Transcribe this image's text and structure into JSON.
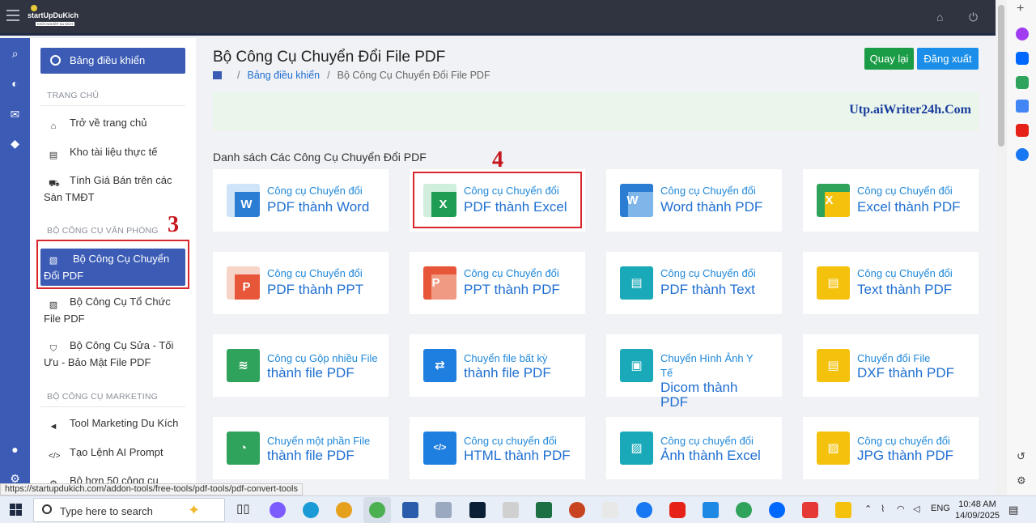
{
  "header": {
    "logo_text": "startUpDuKich",
    "logo_tagline": "KHỞI NGHIỆP DU KÍCH"
  },
  "sidebar": {
    "dashboard_label": "Bảng điều khiển",
    "section_home": "TRANG CHỦ",
    "home_items": [
      "Trở về trang chủ",
      "Kho tài liệu thực tế",
      "Tính Giá Bán trên các Sàn TMĐT"
    ],
    "section_office": "BỘ CÔNG CỤ VĂN PHÒNG",
    "office_items": [
      "Bộ Công Cụ Chuyển Đổi PDF",
      "Bộ Công Cụ Tổ Chức File PDF",
      "Bộ Công Cụ Sửa - Tối Ưu - Bảo Mật File PDF"
    ],
    "section_marketing": "BỘ CÔNG CỤ MARKETING",
    "marketing_items": [
      "Tool Marketing Du Kích",
      "Tạo Lệnh AI Prompt",
      "Bộ hơn 50 công cụ"
    ]
  },
  "annotations": {
    "step3": "3",
    "step4": "4"
  },
  "main": {
    "title": "Bộ Công Cụ Chuyển Đổi File PDF",
    "breadcrumb_link": "Bảng điều khiển",
    "breadcrumb_current": "Bộ Công Cụ Chuyển Đổi File PDF",
    "back_button": "Quay lại",
    "logout_button": "Đăng xuất",
    "banner_brand": "Utp.aiWriter24h.Com",
    "list_title": "Danh sách Các Công Cụ Chuyển Đổi PDF",
    "cards": [
      {
        "line1": "Công cụ Chuyển đổi",
        "line2": "PDF thành Word",
        "glyph": "W"
      },
      {
        "line1": "Công cụ Chuyển đổi",
        "line2": "PDF thành Excel",
        "glyph": "X"
      },
      {
        "line1": "Công cụ Chuyển đổi",
        "line2": "Word thành PDF",
        "glyph": "W"
      },
      {
        "line1": "Công cụ Chuyển đổi",
        "line2": "Excel thành PDF",
        "glyph": "X"
      },
      {
        "line1": "Công cụ Chuyển đổi",
        "line2": "PDF thành PPT",
        "glyph": "P"
      },
      {
        "line1": "Công cụ Chuyển đổi",
        "line2": "PPT thành PDF",
        "glyph": "P"
      },
      {
        "line1": "Công cụ Chuyển đổi",
        "line2": "PDF thành Text",
        "glyph": "▤"
      },
      {
        "line1": "Công cụ Chuyển đổi",
        "line2": "Text thành PDF",
        "glyph": "▤"
      },
      {
        "line1": "Công cụ Gộp nhiều File",
        "line2": "thành file PDF",
        "glyph": "≋"
      },
      {
        "line1": "Chuyển file bất kỳ",
        "line2": "thành file PDF",
        "glyph": "⇄"
      },
      {
        "line1": "Chuyển Hình Ảnh Y Tế",
        "line2": "Dicom thành PDF",
        "glyph": "▣"
      },
      {
        "line1": "Chuyển đổi File",
        "line2": "DXF thành PDF",
        "glyph": "▤"
      },
      {
        "line1": "Chuyển một phần File",
        "line2": "thành file PDF",
        "glyph": "◔"
      },
      {
        "line1": "Công cụ chuyển đổi",
        "line2": "HTML thành PDF",
        "glyph": "</>"
      },
      {
        "line1": "Công cụ chuyển đổi",
        "line2": "Ảnh thành Excel",
        "glyph": "▨"
      },
      {
        "line1": "Công cụ chuyển đổi",
        "line2": "JPG thành PDF",
        "glyph": "▨"
      }
    ]
  },
  "status_url": "https://startupdukich.com/addon-tools/free-tools/pdf-tools/pdf-convert-tools",
  "taskbar": {
    "search_placeholder": "Type here to search",
    "language": "ENG",
    "time": "10:48 AM",
    "date": "14/09/2025"
  },
  "colors": {
    "accent": "#3b5bb5",
    "topbar": "#2f3440",
    "link": "#1f6fd1",
    "back_btn": "#1a9c46",
    "logout_btn": "#1a8ee8",
    "annotation_red": "#d9262c"
  }
}
